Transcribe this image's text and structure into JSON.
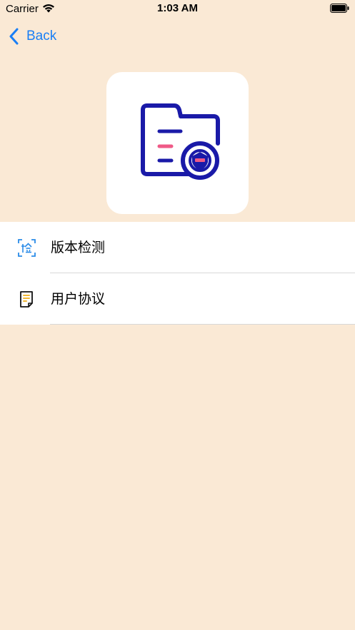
{
  "status_bar": {
    "carrier": "Carrier",
    "time": "1:03 AM"
  },
  "nav": {
    "back_label": "Back"
  },
  "menu": {
    "items": [
      {
        "label": "版本检测",
        "icon": "scan-check-icon"
      },
      {
        "label": "用户协议",
        "icon": "document-icon"
      }
    ]
  },
  "colors": {
    "background": "#fae9d5",
    "accent": "#1a7ff5",
    "app_icon_primary": "#1a1aa8",
    "app_icon_highlight": "#ef5a87"
  }
}
